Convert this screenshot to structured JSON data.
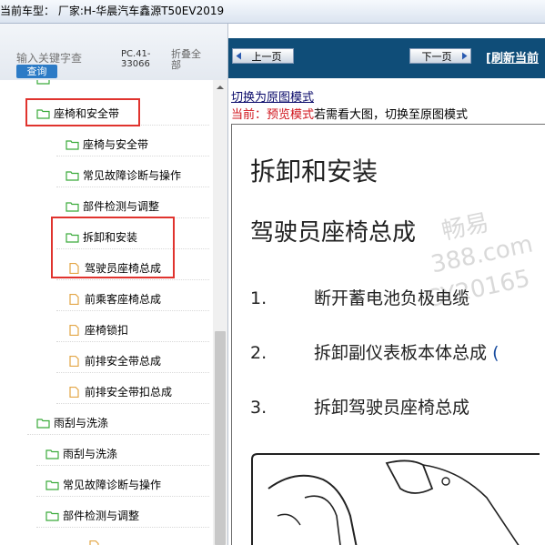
{
  "topbar": {
    "title": "当前车型：  厂家:H-华晨汽车鑫源T50EV2019"
  },
  "search": {
    "placeholder": "输入关键字查",
    "button_label": "查询",
    "pc_code": "PC.41-33066",
    "fold_all": "折叠全部"
  },
  "tree": {
    "items": [
      {
        "label": "座椅和安全带",
        "icon": "folder-open-icon"
      },
      {
        "label": "座椅与安全带",
        "icon": "folder-open-icon"
      },
      {
        "label": "常见故障诊断与操作",
        "icon": "folder-open-icon"
      },
      {
        "label": "部件检测与调整",
        "icon": "folder-open-icon"
      },
      {
        "label": "拆卸和安装",
        "icon": "folder-open-icon"
      },
      {
        "label": "驾驶员座椅总成",
        "icon": "document-icon"
      },
      {
        "label": "前乘客座椅总成",
        "icon": "document-icon"
      },
      {
        "label": "座椅锁扣",
        "icon": "document-icon"
      },
      {
        "label": "前排安全带总成",
        "icon": "document-icon"
      },
      {
        "label": "前排安全带扣总成",
        "icon": "document-icon"
      },
      {
        "label": "雨刮与洗涤",
        "icon": "folder-open-icon"
      },
      {
        "label": "雨刮与洗涤",
        "icon": "folder-open-icon"
      },
      {
        "label": "常见故障诊断与操作",
        "icon": "folder-open-icon"
      },
      {
        "label": "部件检测与调整",
        "icon": "folder-open-icon"
      }
    ]
  },
  "nav": {
    "prev_label": "上一页",
    "next_label": "下一页",
    "refresh_label": "[刷新当前"
  },
  "mode": {
    "switch_link": "切换为原图模式",
    "current_prefix": "当前：",
    "current_mode": "预览模式",
    "hint": "若需看大图，切换至原图模式"
  },
  "document": {
    "title": "拆卸和安装",
    "subtitle": "驾驶员座椅总成",
    "steps": [
      {
        "num": "1.",
        "text": "断开蓄电池负极电缆",
        "suffix": ""
      },
      {
        "num": "2.",
        "text": "拆卸副仪表板本体总成",
        "suffix": "("
      },
      {
        "num": "3.",
        "text": "拆卸驾驶员座椅总成",
        "suffix": ""
      }
    ],
    "watermark": {
      "line1": "畅易",
      "line2": "388.com",
      "line3": "CY20165"
    }
  },
  "colors": {
    "nav_bg": "#0f4d78",
    "highlight_box": "#e0332e",
    "preview_mode": "#d0141c",
    "search_button": "#2c7bc6"
  }
}
